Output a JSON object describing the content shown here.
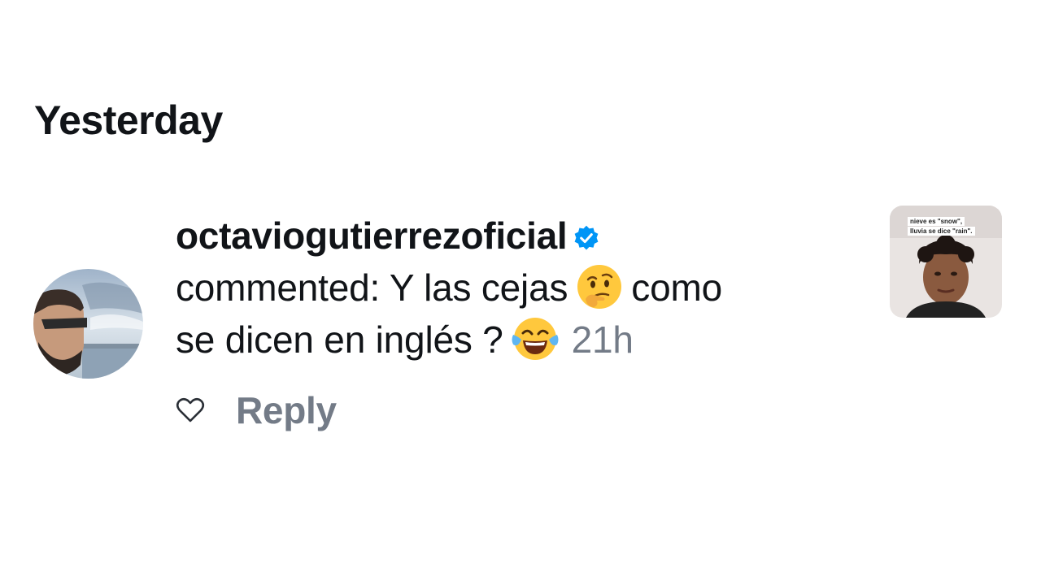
{
  "section": {
    "title": "Yesterday"
  },
  "notification": {
    "username": "octaviogutierrezoficial",
    "verified": true,
    "comment_prefix": "commented: Y las cejas",
    "comment_middle": "como",
    "comment_line2": "se dicen en inglés ?",
    "timestamp": "21h",
    "emoji_1": "thinking-face",
    "emoji_2": "face-with-tears-of-joy",
    "reply_label": "Reply",
    "thumbnail_captions": [
      "nieve es \"snow\",",
      "lluvia se dice \"rain\"."
    ]
  },
  "colors": {
    "text": "#111418",
    "secondary": "#737b87",
    "verified_badge": "#0095f6"
  }
}
